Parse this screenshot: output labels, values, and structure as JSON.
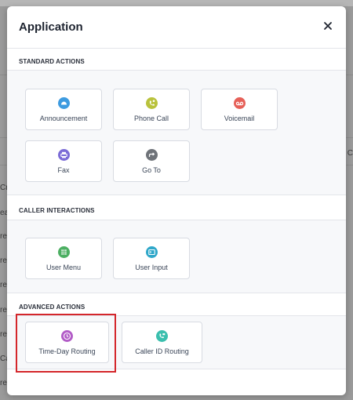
{
  "background": {
    "left_fragments": [
      "Cr",
      "ea",
      "re",
      "re",
      "re",
      "re",
      "re",
      "Ca",
      "re"
    ],
    "right_fragment": "C"
  },
  "modal": {
    "title": "Application",
    "close_label": "×"
  },
  "sections": {
    "standard": {
      "label": "STANDARD ACTIONS",
      "items": [
        {
          "label": "Announcement",
          "icon": "announcement-icon",
          "color": "#3d9be0"
        },
        {
          "label": "Phone Call",
          "icon": "phone-call-icon",
          "color": "#b9c23c"
        },
        {
          "label": "Voicemail",
          "icon": "voicemail-icon",
          "color": "#e66058"
        },
        {
          "label": "Fax",
          "icon": "fax-icon",
          "color": "#7b6bd6"
        },
        {
          "label": "Go To",
          "icon": "goto-icon",
          "color": "#6f7379"
        }
      ]
    },
    "caller": {
      "label": "CALLER INTERACTIONS",
      "items": [
        {
          "label": "User Menu",
          "icon": "user-menu-icon",
          "color": "#4caf62"
        },
        {
          "label": "User Input",
          "icon": "user-input-icon",
          "color": "#2fa7c9"
        }
      ]
    },
    "advanced": {
      "label": "ADVANCED ACTIONS",
      "items": [
        {
          "label": "Time-Day Routing",
          "icon": "clock-icon",
          "color": "#b25cc7"
        },
        {
          "label": "Caller ID Routing",
          "icon": "caller-id-icon",
          "color": "#3bbfae"
        }
      ]
    }
  },
  "highlight_color": "#d4262b"
}
